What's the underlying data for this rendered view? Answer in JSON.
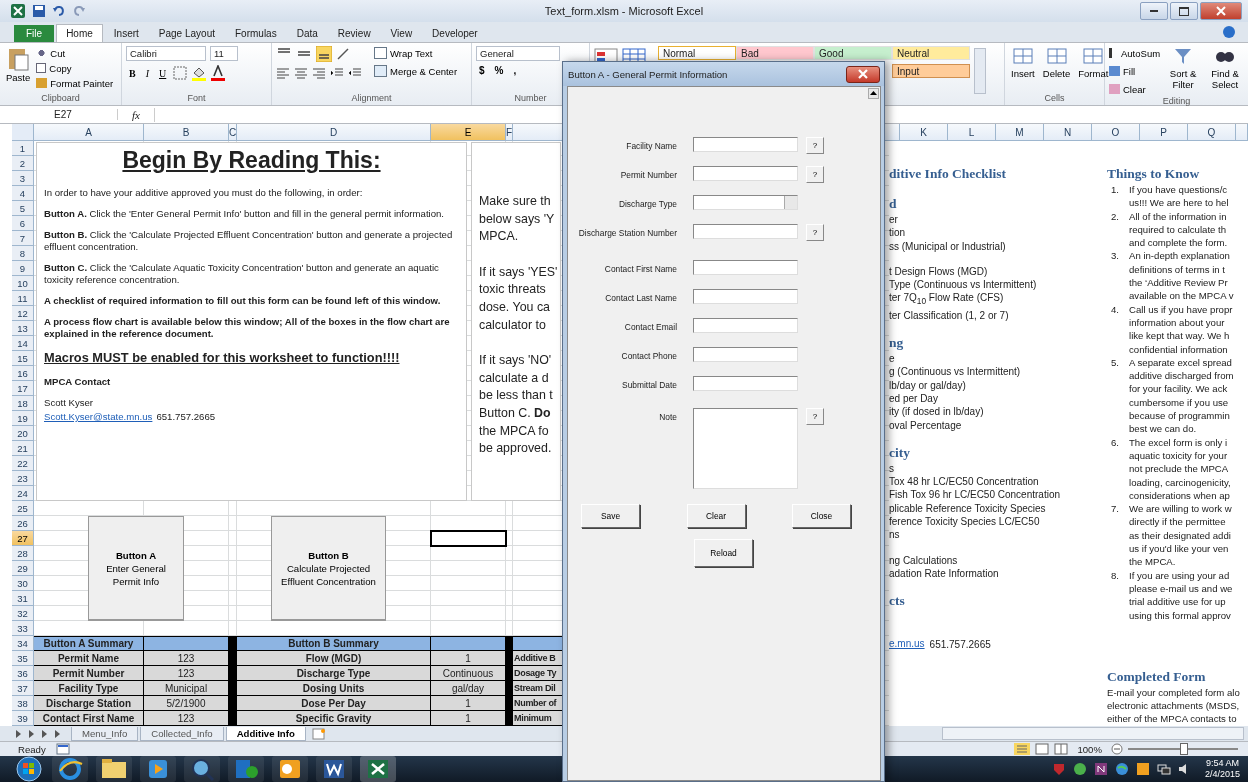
{
  "window": {
    "title": "Text_form.xlsm - Microsoft Excel"
  },
  "ribbon_tabs": [
    {
      "label": "File",
      "kind": "file",
      "selected": false
    },
    {
      "label": "Home",
      "kind": "tab",
      "selected": true
    },
    {
      "label": "Insert",
      "kind": "tab",
      "selected": false
    },
    {
      "label": "Page Layout",
      "kind": "tab",
      "selected": false
    },
    {
      "label": "Formulas",
      "kind": "tab",
      "selected": false
    },
    {
      "label": "Data",
      "kind": "tab",
      "selected": false
    },
    {
      "label": "Review",
      "kind": "tab",
      "selected": false
    },
    {
      "label": "View",
      "kind": "tab",
      "selected": false
    },
    {
      "label": "Developer",
      "kind": "tab",
      "selected": false
    }
  ],
  "ribbon": {
    "clipboard": {
      "paste": "Paste",
      "cut": "Cut",
      "copy": "Copy",
      "format_painter": "Format Painter",
      "label": "Clipboard"
    },
    "font": {
      "family": "Calibri",
      "size": "11",
      "buttons": [
        "B",
        "I",
        "U"
      ],
      "label": "Font"
    },
    "alignment": {
      "wrap": "Wrap Text",
      "merge": "Merge & Center",
      "label": "Alignment"
    },
    "number": {
      "format": "General",
      "buttons": [
        "$",
        "%",
        ","
      ],
      "label": "Number"
    },
    "styles_top": [
      {
        "label": "Normal",
        "color": "#ffffff"
      },
      {
        "label": "Bad",
        "color": "#ffc7ce"
      },
      {
        "label": "Good",
        "color": "#c6efce"
      },
      {
        "label": "Neutral",
        "color": "#ffeb9c"
      }
    ],
    "styles_bottom": [
      {
        "label": "Input",
        "color": "#ffcc99"
      }
    ],
    "cells": {
      "buttons": [
        "Insert",
        "Delete",
        "Format"
      ],
      "label": "Cells"
    },
    "editing": {
      "autosum": "AutoSum",
      "fill": "Fill",
      "clear": "Clear",
      "sort": "Sort & Filter",
      "find": "Find & Select",
      "label": "Editing"
    }
  },
  "formula_bar": {
    "name_box": "E27",
    "fx": "fx"
  },
  "columns_left": [
    {
      "label": "A",
      "selected": false
    },
    {
      "label": "B",
      "selected": false
    },
    {
      "label": "C",
      "selected": false
    },
    {
      "label": "D",
      "selected": false
    },
    {
      "label": "E",
      "selected": true
    },
    {
      "label": "F",
      "selected": false
    }
  ],
  "columns_right": [
    {
      "label": "K",
      "selected": false
    },
    {
      "label": "L",
      "selected": false
    },
    {
      "label": "M",
      "selected": false
    },
    {
      "label": "N",
      "selected": false
    },
    {
      "label": "O",
      "selected": false
    },
    {
      "label": "P",
      "selected": false
    },
    {
      "label": "Q",
      "selected": false
    }
  ],
  "rows": [
    {
      "n": "1",
      "selected": false
    },
    {
      "n": "2",
      "selected": false
    },
    {
      "n": "3",
      "selected": false
    },
    {
      "n": "4",
      "selected": false
    },
    {
      "n": "5",
      "selected": false
    },
    {
      "n": "6",
      "selected": false
    },
    {
      "n": "7",
      "selected": false
    },
    {
      "n": "8",
      "selected": false
    },
    {
      "n": "9",
      "selected": false
    },
    {
      "n": "10",
      "selected": false
    },
    {
      "n": "11",
      "selected": false
    },
    {
      "n": "12",
      "selected": false
    },
    {
      "n": "13",
      "selected": false
    },
    {
      "n": "14",
      "selected": false
    },
    {
      "n": "15",
      "selected": false
    },
    {
      "n": "16",
      "selected": false
    },
    {
      "n": "17",
      "selected": false
    },
    {
      "n": "18",
      "selected": false
    },
    {
      "n": "19",
      "selected": false
    },
    {
      "n": "20",
      "selected": false
    },
    {
      "n": "21",
      "selected": false
    },
    {
      "n": "22",
      "selected": false
    },
    {
      "n": "23",
      "selected": false
    },
    {
      "n": "24",
      "selected": false
    },
    {
      "n": "25",
      "selected": false
    },
    {
      "n": "26",
      "selected": false
    },
    {
      "n": "27",
      "selected": true
    },
    {
      "n": "28",
      "selected": false
    },
    {
      "n": "29",
      "selected": false
    },
    {
      "n": "30",
      "selected": false
    },
    {
      "n": "31",
      "selected": false
    },
    {
      "n": "32",
      "selected": false
    },
    {
      "n": "33",
      "selected": false
    },
    {
      "n": "34",
      "selected": false
    },
    {
      "n": "35",
      "selected": false
    },
    {
      "n": "36",
      "selected": false
    },
    {
      "n": "37",
      "selected": false
    },
    {
      "n": "38",
      "selected": false
    },
    {
      "n": "39",
      "selected": false
    }
  ],
  "intro_box": {
    "heading": "Begin By Reading This:",
    "paragraphs": [
      {
        "kind": "text",
        "text": "In order to have your additive approved you must do the following, in order:"
      },
      {
        "kind": "text",
        "text": "**Button A.** Click the 'Enter General Permit Info' button and fill in the general permit information."
      },
      {
        "kind": "text",
        "text": "**Button B.** Click the 'Calculate Projected Effluent Concentration' button and generate a projected effluent concentration."
      },
      {
        "kind": "text",
        "text": "**Button C.** Click the 'Calculate Aquatic Toxicity Concentration' button and generate an aquatic toxicity reference concentration."
      },
      {
        "kind": "bold",
        "text": "A checklist of required information to fill out this form can be found left of this window."
      },
      {
        "kind": "bold",
        "text": "A process flow chart is available below this window; All of the boxes in the flow chart are explained in the reference document."
      },
      {
        "kind": "warning",
        "text": "Macros MUST be enabled for this worksheet to function!!!!"
      },
      {
        "kind": "bold",
        "text": "MPCA Contact"
      }
    ],
    "contact_name": "Scott Kyser",
    "contact_email": "Scott.Kyser@state.mn.us",
    "contact_phone": "651.757.2665"
  },
  "side_box": [
    [
      "Make sure th",
      "below says 'Y",
      "MPCA."
    ],
    [
      "If it says 'YES'",
      "toxic threats",
      "dose.  You ca",
      "calculator to"
    ],
    [
      "If it says 'NO'",
      "calculate a d",
      "be less than t",
      "Button C.  **Do**",
      "the MPCA fo",
      "be approved."
    ]
  ],
  "sheet_buttons": [
    {
      "title": "Button A",
      "caption": "Enter General Permit Info"
    },
    {
      "title": "Button B",
      "caption": "Calculate Projected Effluent Concentration"
    }
  ],
  "summary": {
    "header_a": "Button A Summary",
    "header_b": "Button B Summary",
    "rows": [
      {
        "a_label": "Permit Name",
        "a_value": "123",
        "b_label": "Flow  (MGD)",
        "b_value": "1",
        "c_label": "Additive B"
      },
      {
        "a_label": "Permit Number",
        "a_value": "123",
        "b_label": "Discharge Type",
        "b_value": "Continuous",
        "c_label": "Dosage Ty"
      },
      {
        "a_label": "Facility Type",
        "a_value": "Municipal",
        "b_label": "Dosing Units",
        "b_value": "gal/day",
        "c_label": "Stream Dil"
      },
      {
        "a_label": "Discharge Station",
        "a_value": "5/2/1900",
        "b_label": "Dose Per Day",
        "b_value": "1",
        "c_label": "Number of"
      },
      {
        "a_label": "Contact First Name",
        "a_value": "123",
        "b_label": "Specific Gravity",
        "b_value": "1",
        "c_label": "Minimum"
      }
    ]
  },
  "checklist": [
    {
      "heading": "ditive Info Checklist"
    },
    {
      "heading": "d",
      "lines": [
        "er",
        "tion",
        "ss (Municipal or Industrial)"
      ]
    },
    {
      "lines": [
        "t Design Flows (MGD)",
        "Type (Continuous vs Intermittent)",
        "ter 7Q$_{10}$ Flow Rate (CFS)",
        "ter Classification (1, 2 or 7)"
      ]
    },
    {
      "heading": "ng",
      "lines": [
        "e",
        "g (Continuous vs Intermittent)",
        "lb/day or gal/day)",
        "ed per Day",
        "ity (if dosed in lb/day)",
        "oval Percentage"
      ]
    },
    {
      "heading": "city",
      "lines": [
        "s",
        "Tox 48 hr LC/EC50 Concentration",
        "Fish Tox 96 hr LC/EC50 Concentration",
        "plicable Reference Toxicity Species",
        "ference Toxicity Species LC/EC50",
        "ns"
      ]
    },
    {
      "lines": [
        "ng Calculations",
        "adation Rate Information"
      ]
    },
    {
      "heading": "cts"
    }
  ],
  "checklist_contact": {
    "link": "e.mn.us",
    "phone": "651.757.2665"
  },
  "things_to_know": {
    "heading": "Things to Know",
    "items": [
      {
        "number": "1.",
        "lines": [
          "If you have questions/c",
          "us!!! We are here to hel"
        ]
      },
      {
        "number": "2.",
        "lines": [
          "All of the information in",
          "required to calculate th",
          "and complete the form."
        ]
      },
      {
        "number": "3.",
        "lines": [
          "An in-depth explanation",
          "definitions of terms in t",
          "the ‘Additive Review Pr",
          "available on the MPCA v"
        ]
      },
      {
        "number": "4.",
        "lines": [
          "Call us if you have propr",
          "information about your",
          "like kept that way. We h",
          "confidential information"
        ]
      },
      {
        "number": "5.",
        "lines": [
          "A separate excel spread",
          "additive discharged from",
          "for your facility. We ack",
          "cumbersome if you use",
          "because of programmin",
          "best we can do."
        ]
      },
      {
        "number": "6.",
        "lines": [
          "The excel form is only i",
          "aquatic toxicity for your",
          "not preclude the MPCA",
          "loading, carcinogenicity,",
          "considerations when ap"
        ]
      },
      {
        "number": "7.",
        "lines": [
          "We are willing to work w",
          "directly if the permittee",
          "as their designated addi",
          "us if you'd like your ven",
          "the MPCA."
        ]
      },
      {
        "number": "8.",
        "lines": [
          "If you are using your ad",
          "please e-mail us and we",
          "trial additive use for up",
          "using this formal approv"
        ]
      }
    ]
  },
  "completed_form": {
    "heading": "Completed Form",
    "lines": [
      "E-mail your completed form alo",
      "electronic attachments (MSDS, ",
      "either of the MPCA contacts to "
    ]
  },
  "sheet_tabs": [
    {
      "label": "Menu_Info",
      "selected": false
    },
    {
      "label": "Collected_Info",
      "selected": false
    },
    {
      "label": "Additive Info",
      "selected": true
    }
  ],
  "status_bar": {
    "status": "Ready",
    "zoom": "100%",
    "level": 0.5
  },
  "taskbar": {
    "time": "9:54 AM",
    "date": "2/4/2015"
  },
  "dialog": {
    "title": "Button A - General Permit Information",
    "fields": [
      {
        "label": "Facility Name",
        "kind": "text",
        "help": true
      },
      {
        "label": "Permit Number",
        "kind": "text",
        "help": true
      },
      {
        "label": "Discharge Type",
        "kind": "dropdown",
        "help": false
      },
      {
        "label": "Discharge Station Number",
        "kind": "text",
        "help": true
      },
      {
        "label": "Contact First Name",
        "kind": "text",
        "help": false
      },
      {
        "label": "Contact Last Name",
        "kind": "text",
        "help": false
      },
      {
        "label": "Contact Email",
        "kind": "text",
        "help": false
      },
      {
        "label": "Contact Phone",
        "kind": "text",
        "help": false
      },
      {
        "label": "Submittal Date",
        "kind": "text",
        "help": false
      },
      {
        "label": "Note",
        "kind": "textarea",
        "help": true
      }
    ],
    "help_label": "?",
    "buttons_row": [
      "Save",
      "Clear",
      "Close"
    ],
    "extra_button": "Reload"
  }
}
